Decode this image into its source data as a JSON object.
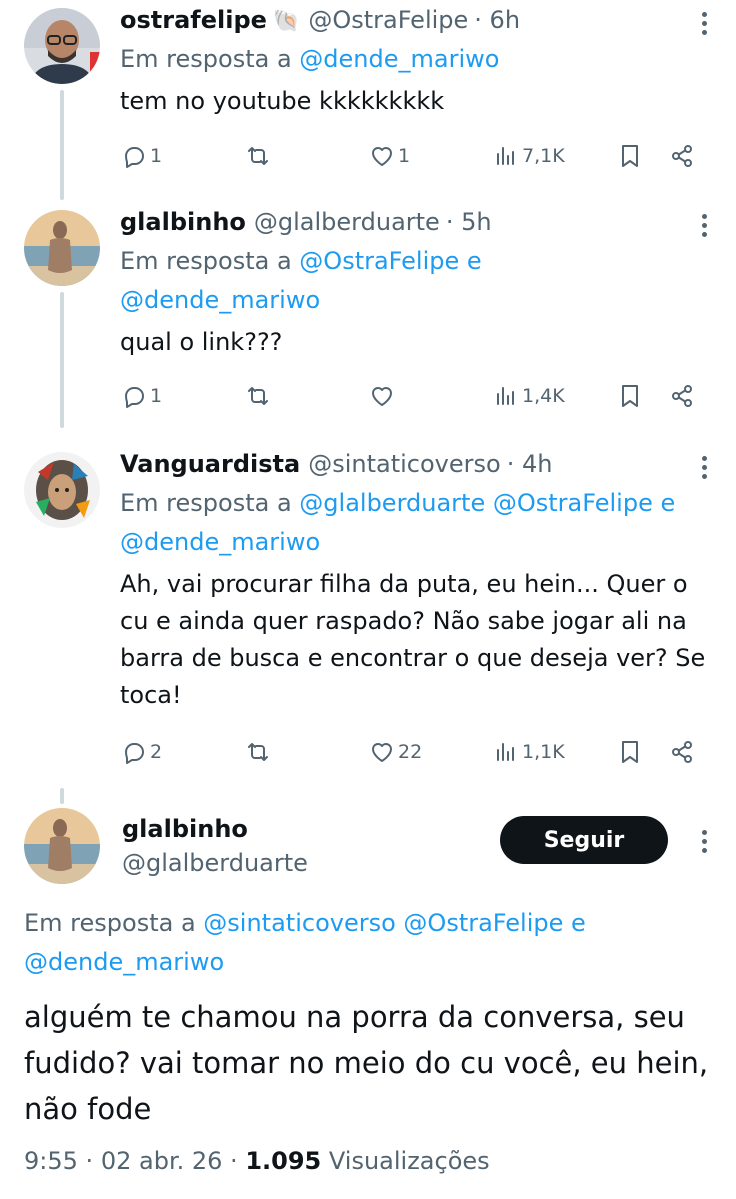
{
  "colors": {
    "link": "#1d9bf0",
    "text": "#0f1419",
    "muted": "#536471",
    "line": "#cfd9de"
  },
  "replies": [
    {
      "name": "ostrafelipe",
      "name_emoji": "🐚",
      "handle": "@OstraFelipe",
      "time": "· 6h",
      "reply_prefix": "Em resposta a",
      "reply_links": [
        "@dende_mariwo"
      ],
      "reply_suffix": "",
      "text": "tem no youtube kkkkkkkkk",
      "replies_count": "1",
      "likes_count": "1",
      "views": "7,1K"
    },
    {
      "name": "glalbinho",
      "handle": "@glalberduarte",
      "time": "· 5h",
      "reply_prefix": "Em resposta a",
      "reply_links": [
        "@OstraFelipe",
        "@dende_mariwo"
      ],
      "reply_conj": "e",
      "text": "qual o link???",
      "replies_count": "1",
      "likes_count": "",
      "views": "1,4K"
    },
    {
      "name": "Vanguardista",
      "handle": "@sintaticoverso",
      "time": "· 4h",
      "reply_prefix": "Em resposta a",
      "reply_links": [
        "@glalberduarte",
        "@OstraFelipe",
        "@dende_mariwo"
      ],
      "reply_conj": "e",
      "text": "Ah, vai procurar filha da puta, eu hein... Quer o cu e ainda quer raspado? Não sabe jogar ali na barra de busca e encontrar o que deseja ver? Se toca!",
      "replies_count": "2",
      "likes_count": "22",
      "views": "1,1K"
    }
  ],
  "main_tweet": {
    "name": "glalbinho",
    "handle": "@glalberduarte",
    "follow_label": "Seguir",
    "reply_prefix": "Em resposta a",
    "reply_links": [
      "@sintaticoverso",
      "@OstraFelipe",
      "@dende_mariwo"
    ],
    "reply_conj": "e",
    "text": "alguém te chamou na porra da conversa, seu fudido? vai tomar no meio do cu você, eu hein, não fode",
    "time": "9:55",
    "date": "02 abr. 26",
    "views_count": "1.095",
    "views_label": "Visualizações"
  }
}
